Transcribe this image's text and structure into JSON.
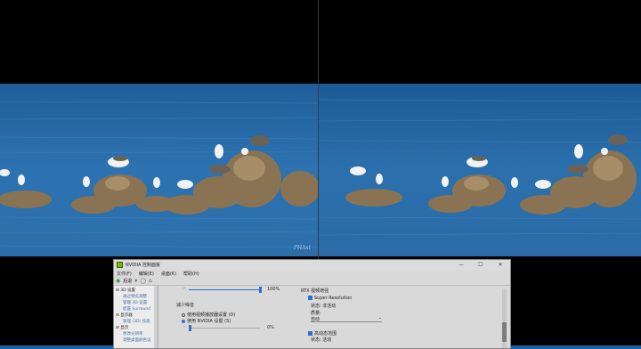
{
  "video": {
    "watermark": "PHAst"
  },
  "window": {
    "title": "NVIDIA 控制面板",
    "controls": {
      "minimize": "—",
      "maximize": "☐",
      "close": "✕"
    }
  },
  "menu": [
    "文件(F)",
    "编辑(E)",
    "桌面(K)",
    "帮助(H)"
  ],
  "toolbar": {
    "back_label": "后退",
    "back_icon": "back-arrow-icon"
  },
  "tree": [
    {
      "label": "3D 设置",
      "type": "cat",
      "toggle": "⊟"
    },
    {
      "label": "通过预览调整",
      "type": "sub"
    },
    {
      "label": "管理 3D 设置",
      "type": "sub"
    },
    {
      "label": "配置 Surround",
      "type": "sub"
    },
    {
      "label": "显示器",
      "type": "cat",
      "toggle": "⊟"
    },
    {
      "label": "管理 (3D) 技能",
      "type": "sub"
    },
    {
      "label": "显示",
      "type": "cat",
      "toggle": "⊟"
    },
    {
      "label": "更改分辨率",
      "type": "sub"
    },
    {
      "label": "调整桌面颜色设",
      "type": "sub"
    }
  ],
  "settings": {
    "top_slider_value": "100%",
    "top_slider_level": 1.0,
    "noise_title": "减少噪音",
    "option_video_player": "使用视频播放器设置 (D)",
    "option_nvidia": "使用 NVIDIA 设置 (S)",
    "nvidia_selected": true,
    "noise_slider_value": "0%",
    "noise_slider_level": 0.0,
    "rtx_title": "RTX 视频增强",
    "super_resolution_label": "Super Resolution",
    "super_resolution_checked": true,
    "status_label": "状态: 非活动",
    "quality_label": "质量:",
    "quality_value": "自动",
    "hdr_label": "高动态范围",
    "hdr_checked": true,
    "hdr_status": "状态: 活动"
  }
}
